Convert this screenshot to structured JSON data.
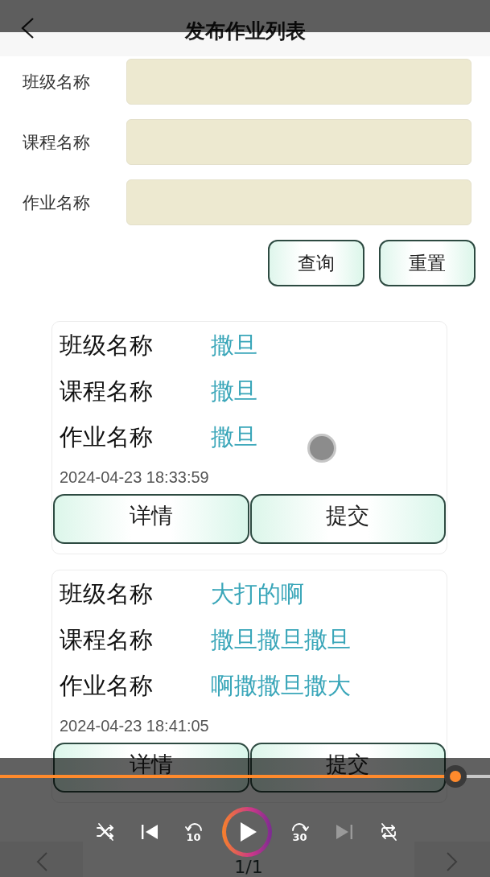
{
  "header": {
    "title": "发布作业列表"
  },
  "search_form": {
    "fields": [
      {
        "label": "班级名称"
      },
      {
        "label": "课程名称"
      },
      {
        "label": "作业名称"
      }
    ],
    "buttons": [
      "查询",
      "重置"
    ]
  },
  "records": [
    {
      "fields": [
        {
          "label": "班级名称",
          "value": "撒旦"
        },
        {
          "label": "课程名称",
          "value": "撒旦"
        },
        {
          "label": "作业名称",
          "value": "撒旦"
        }
      ],
      "time": "2024-04-23 18:33:59",
      "actions": [
        "详情",
        "提交"
      ]
    },
    {
      "fields": [
        {
          "label": "班级名称",
          "value": "大打的啊"
        },
        {
          "label": "课程名称",
          "value": "撒旦撒旦撒旦"
        },
        {
          "label": "作业名称",
          "value": "啊撒撒旦撒大"
        }
      ],
      "time": "2024-04-23 18:41:05",
      "actions": [
        "详情",
        "提交"
      ]
    }
  ],
  "pager": {
    "page": "1/1"
  },
  "player": {
    "progress": {
      "level": 0.93
    },
    "controls": [
      {
        "kind": "shuffle",
        "disabled": false
      },
      {
        "kind": "previous",
        "disabled": false
      },
      {
        "kind": "rewind",
        "label": "10",
        "disabled": false
      },
      {
        "kind": "play",
        "disabled": false
      },
      {
        "kind": "forward",
        "label": "30",
        "disabled": false
      },
      {
        "kind": "next",
        "disabled": true
      },
      {
        "kind": "repeat",
        "disabled": false
      }
    ]
  }
}
